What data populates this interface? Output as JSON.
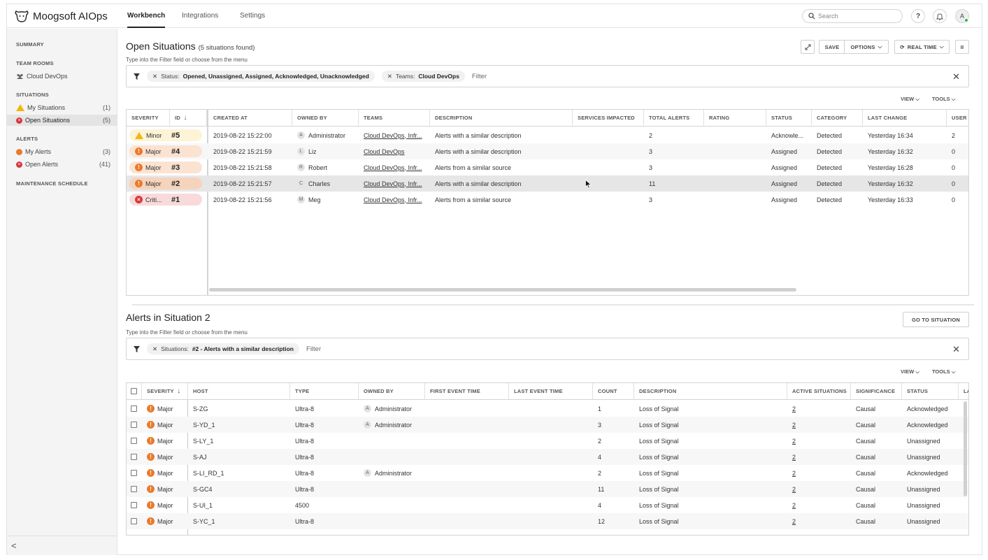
{
  "app": {
    "name": "Moogsoft AIOps"
  },
  "nav": {
    "tabs": [
      "Workbench",
      "Integrations",
      "Settings"
    ],
    "search_placeholder": "Search",
    "help": "?",
    "avatar": "A"
  },
  "sidebar": {
    "summary": "SUMMARY",
    "team_rooms": "TEAM ROOMS",
    "team_item": "Cloud DevOps",
    "situations": "SITUATIONS",
    "my_situations": {
      "label": "My Situations",
      "count": "(1)"
    },
    "open_situations": {
      "label": "Open Situations",
      "count": "(5)"
    },
    "alerts": "ALERTS",
    "my_alerts": {
      "label": "My Alerts",
      "count": "(3)"
    },
    "open_alerts": {
      "label": "Open Alerts",
      "count": "(41)"
    },
    "maintenance": "MAINTENANCE SCHEDULE",
    "collapse": "<"
  },
  "situations_panel": {
    "title": "Open Situations",
    "subtitle": "(5 situations found)",
    "hint": "Type into the Filter field or choose from the menu",
    "save": "SAVE",
    "options": "OPTIONS",
    "realtime": "REAL TIME",
    "pause": "II",
    "filter_chip1_key": "Status:",
    "filter_chip1_val": "Opened, Unassigned, Assigned, Acknowledged, Unacknowledged",
    "filter_chip2_key": "Teams:",
    "filter_chip2_val": "Cloud DevOps",
    "filter_placeholder": "Filter",
    "view": "VIEW",
    "tools": "TOOLS",
    "columns": [
      "SEVERITY",
      "ID",
      "CREATED AT",
      "OWNED BY",
      "TEAMS",
      "DESCRIPTION",
      "SERVICES IMPACTED",
      "TOTAL ALERTS",
      "RATING",
      "STATUS",
      "CATEGORY",
      "LAST CHANGE",
      "USER C"
    ],
    "rows": [
      {
        "severity": "Minor",
        "id": "#5",
        "created": "2019-08-22 15:22:00",
        "owner_initial": "A",
        "owner": "Administrator",
        "teams": "Cloud DevOps, Infr...",
        "description": "Alerts with a similar description",
        "total": "2",
        "status": "Acknowle...",
        "category": "Detected",
        "last_change": "Yesterday 16:34",
        "user": "2"
      },
      {
        "severity": "Major",
        "id": "#4",
        "created": "2019-08-22 15:21:59",
        "owner_initial": "L",
        "owner": "Liz",
        "teams": "Cloud DevOps",
        "description": "Alerts with a similar description",
        "total": "3",
        "status": "Assigned",
        "category": "Detected",
        "last_change": "Yesterday 16:32",
        "user": "0"
      },
      {
        "severity": "Major",
        "id": "#3",
        "created": "2019-08-22 15:21:58",
        "owner_initial": "R",
        "owner": "Robert",
        "teams": "Cloud DevOps, Infr...",
        "description": "Alerts from a similar source",
        "total": "3",
        "status": "Assigned",
        "category": "Detected",
        "last_change": "Yesterday 16:28",
        "user": "0"
      },
      {
        "severity": "Major",
        "id": "#2",
        "created": "2019-08-22 15:21:57",
        "owner_initial": "C",
        "owner": "Charles",
        "teams": "Cloud DevOps, Infr...",
        "description": "Alerts with a similar description",
        "total": "11",
        "status": "Assigned",
        "category": "Detected",
        "last_change": "Yesterday 16:32",
        "user": "0"
      },
      {
        "severity": "Criti...",
        "id": "#1",
        "created": "2019-08-22 15:21:56",
        "owner_initial": "M",
        "owner": "Meg",
        "teams": "Cloud DevOps, Infr...",
        "description": "Alerts from a similar source",
        "total": "3",
        "status": "Assigned",
        "category": "Detected",
        "last_change": "Yesterday 16:33",
        "user": "0"
      }
    ]
  },
  "alerts_panel": {
    "title": "Alerts in Situation 2",
    "hint": "Type into the Filter field or choose from the menu",
    "goto": "GO TO SITUATION",
    "filter_chip_key": "Situations:",
    "filter_chip_val": "#2 - Alerts with a similar description",
    "filter_placeholder": "Filter",
    "view": "VIEW",
    "tools": "TOOLS",
    "columns": [
      "SEVERITY",
      "HOST",
      "TYPE",
      "OWNED BY",
      "FIRST EVENT TIME",
      "LAST EVENT TIME",
      "COUNT",
      "DESCRIPTION",
      "ACTIVE SITUATIONS",
      "SIGNIFICANCE",
      "STATUS",
      "LA"
    ],
    "rows": [
      {
        "severity": "Major",
        "host": "S-ZG",
        "type": "Ultra-8",
        "owner": "Administrator",
        "count": "1",
        "description": "Loss of Signal",
        "active": "2",
        "significance": "Causal",
        "status": "Acknowledged"
      },
      {
        "severity": "Major",
        "host": "S-YD_1",
        "type": "Ultra-8",
        "owner": "Administrator",
        "count": "3",
        "description": "Loss of Signal",
        "active": "2",
        "significance": "Causal",
        "status": "Acknowledged"
      },
      {
        "severity": "Major",
        "host": "S-LY_1",
        "type": "Ultra-8",
        "owner": "",
        "count": "2",
        "description": "Loss of Signal",
        "active": "2",
        "significance": "Causal",
        "status": "Unassigned"
      },
      {
        "severity": "Major",
        "host": "S-AJ",
        "type": "Ultra-8",
        "owner": "",
        "count": "4",
        "description": "Loss of Signal",
        "active": "2",
        "significance": "Causal",
        "status": "Unassigned"
      },
      {
        "severity": "Major",
        "host": "S-LI_RD_1",
        "type": "Ultra-8",
        "owner": "Administrator",
        "count": "2",
        "description": "Loss of Signal",
        "active": "2",
        "significance": "Causal",
        "status": "Acknowledged"
      },
      {
        "severity": "Major",
        "host": "S-GC4",
        "type": "Ultra-8",
        "owner": "",
        "count": "11",
        "description": "Loss of Signal",
        "active": "2",
        "significance": "Causal",
        "status": "Unassigned"
      },
      {
        "severity": "Major",
        "host": "S-UI_1",
        "type": "4500",
        "owner": "",
        "count": "4",
        "description": "Loss of Signal",
        "active": "2",
        "significance": "Causal",
        "status": "Unassigned"
      },
      {
        "severity": "Major",
        "host": "S-YC_1",
        "type": "Ultra-8",
        "owner": "",
        "count": "12",
        "description": "Loss of Signal",
        "active": "2",
        "significance": "Causal",
        "status": "Unassigned"
      }
    ]
  },
  "colors": {
    "minor": "#f2b60d",
    "major": "#ea7a2c",
    "critical": "#d6393d",
    "minor_bg": "#fdf3d6",
    "major_bg": "#fbe3d2",
    "critical_bg": "#f9dada"
  }
}
